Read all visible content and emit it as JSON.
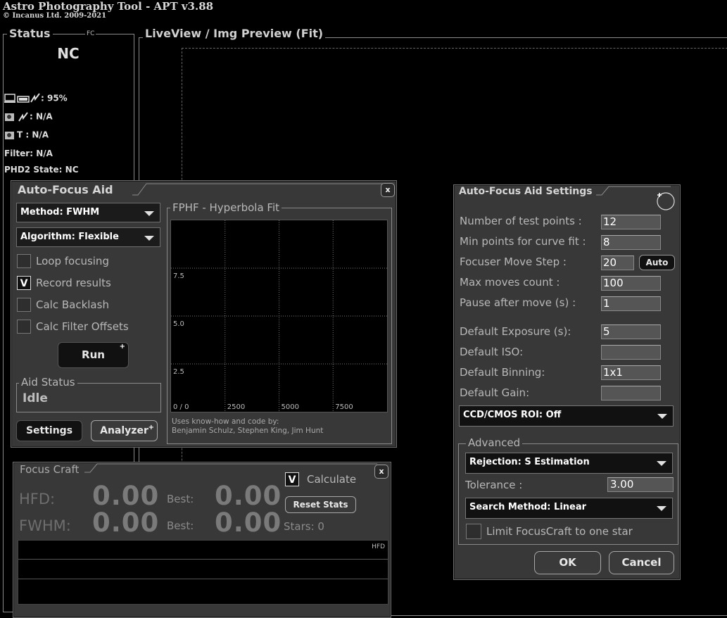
{
  "app": {
    "title": "Astro Photography Tool  -  APT v3.88",
    "copyright": "© Incanus Ltd. 2009-2021"
  },
  "status": {
    "title": "Status",
    "fc_tag": "FC",
    "state": "NC",
    "battery": ": 95%",
    "camera_power": ": N/A",
    "camera_temp": "T :  N/A",
    "filter": "Filter: N/A",
    "phd2": "PHD2 State: NC"
  },
  "liveview": {
    "title": "LiveView / Img Preview (Fit)"
  },
  "autofocus_aid": {
    "title": "Auto-Focus Aid",
    "close": "x",
    "method": "Method: FWHM",
    "algorithm": "Algorithm: Flexible",
    "checkboxes": [
      {
        "label": "Loop focusing",
        "checked": false,
        "mark": ""
      },
      {
        "label": "Record results",
        "checked": true,
        "mark": "V"
      },
      {
        "label": "Calc Backlash",
        "checked": false,
        "mark": ""
      },
      {
        "label": "Calc Filter Offsets",
        "checked": false,
        "mark": ""
      }
    ],
    "run": "Run",
    "plus": "+",
    "aid_status_title": "Aid Status",
    "aid_status_value": "Idle",
    "settings_button": "Settings",
    "analyzer_button": "Analyzer",
    "chart_title": "FPHF - Hyperbola Fit",
    "credit_line1": "Uses know-how and code by:",
    "credit_line2": "Benjamin Schulz, Stephen King, Jim Hunt"
  },
  "chart_data": {
    "type": "line",
    "title": "FPHF - Hyperbola Fit",
    "x_tick_labels": [
      "0 / 0",
      "2500",
      "5000",
      "7500"
    ],
    "y_tick_labels": [
      "2.5",
      "5.0",
      "7.5"
    ],
    "xlim": [
      0,
      10000
    ],
    "ylim": [
      0,
      10
    ],
    "grid": true,
    "series": []
  },
  "settings": {
    "title": "Auto-Focus Aid Settings",
    "fields": [
      {
        "label": "Number of test points :",
        "value": "12"
      },
      {
        "label": "Min points for curve fit :",
        "value": "8"
      },
      {
        "label": "Focuser Move Step :",
        "value": "20"
      },
      {
        "label": "Max moves count :",
        "value": "100"
      },
      {
        "label": "Pause after move (s) :",
        "value": "1"
      },
      {
        "label": "Default Exposure (s):",
        "value": "5"
      },
      {
        "label": "Default ISO:",
        "value": ""
      },
      {
        "label": "Default Binning:",
        "value": "1x1"
      },
      {
        "label": "Default Gain:",
        "value": ""
      }
    ],
    "auto_button": "Auto",
    "roi": "CCD/CMOS ROI: Off",
    "advanced_title": "Advanced",
    "rejection": "Rejection: S Estimation",
    "tolerance_label": "Tolerance :",
    "tolerance_value": "3.00",
    "search_method": "Search Method: Linear",
    "limit_label": "Limit FocusCraft to one star",
    "ok": "OK",
    "cancel": "Cancel"
  },
  "focus_craft": {
    "title": "Focus Craft",
    "close": "x",
    "hfd_label": "HFD:",
    "hfd_value": "0.00",
    "fwhm_label": "FWHM:",
    "fwhm_value": "0.00",
    "best_label": "Best:",
    "best_hfd": "0.00",
    "best_fwhm": "0.00",
    "calculate_label": "Calculate",
    "calculate_mark": "V",
    "reset_button": "Reset Stats",
    "stars_label": "Stars:",
    "stars_value": "0",
    "graph_label": "HFD"
  }
}
